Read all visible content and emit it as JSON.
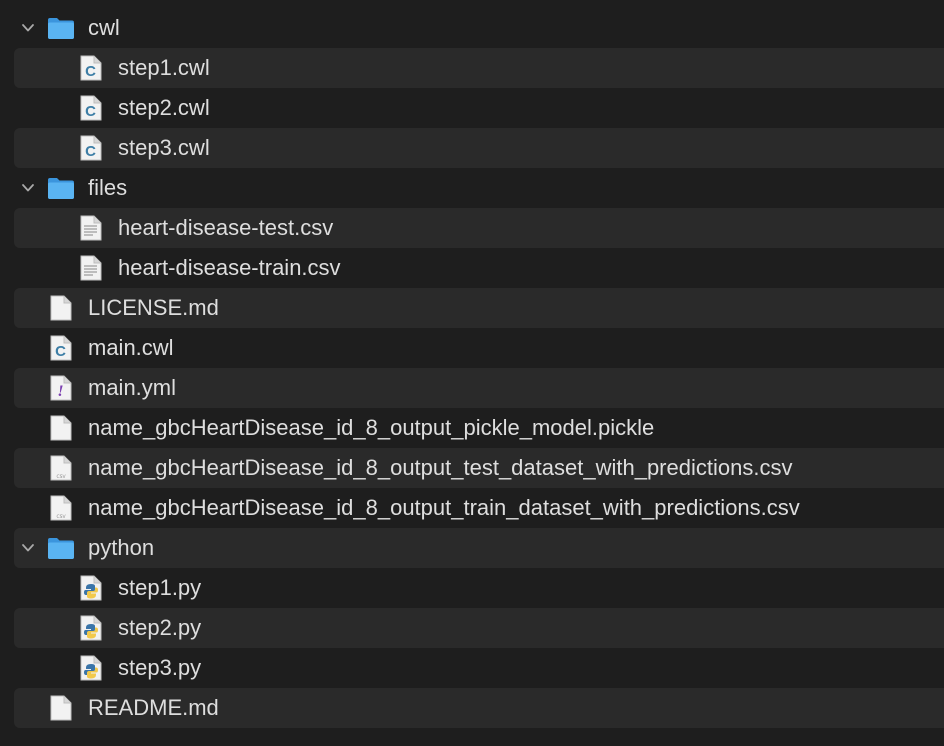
{
  "tree": [
    {
      "label": "cwl",
      "type": "folder",
      "depth": 0,
      "expanded": true,
      "icon": "folder-icon"
    },
    {
      "label": "step1.cwl",
      "type": "cwl",
      "depth": 1,
      "icon": "cwl-file-icon"
    },
    {
      "label": "step2.cwl",
      "type": "cwl",
      "depth": 1,
      "icon": "cwl-file-icon"
    },
    {
      "label": "step3.cwl",
      "type": "cwl",
      "depth": 1,
      "icon": "cwl-file-icon"
    },
    {
      "label": "files",
      "type": "folder",
      "depth": 0,
      "expanded": true,
      "icon": "folder-icon"
    },
    {
      "label": "heart-disease-test.csv",
      "type": "text",
      "depth": 1,
      "icon": "text-file-icon"
    },
    {
      "label": "heart-disease-train.csv",
      "type": "text",
      "depth": 1,
      "icon": "text-file-icon"
    },
    {
      "label": "LICENSE.md",
      "type": "blank",
      "depth": 0,
      "icon": "document-icon"
    },
    {
      "label": "main.cwl",
      "type": "cwl",
      "depth": 0,
      "icon": "cwl-file-icon"
    },
    {
      "label": "main.yml",
      "type": "yml",
      "depth": 0,
      "icon": "yaml-file-icon"
    },
    {
      "label": "name_gbcHeartDisease_id_8_output_pickle_model.pickle",
      "type": "blank",
      "depth": 0,
      "icon": "document-icon"
    },
    {
      "label": "name_gbcHeartDisease_id_8_output_test_dataset_with_predictions.csv",
      "type": "csv",
      "depth": 0,
      "icon": "csv-file-icon",
      "badge": "CSV"
    },
    {
      "label": "name_gbcHeartDisease_id_8_output_train_dataset_with_predictions.csv",
      "type": "csv",
      "depth": 0,
      "icon": "csv-file-icon",
      "badge": "CSV"
    },
    {
      "label": "python",
      "type": "folder",
      "depth": 0,
      "expanded": true,
      "icon": "folder-icon"
    },
    {
      "label": "step1.py",
      "type": "py",
      "depth": 1,
      "icon": "python-file-icon"
    },
    {
      "label": "step2.py",
      "type": "py",
      "depth": 1,
      "icon": "python-file-icon"
    },
    {
      "label": "step3.py",
      "type": "py",
      "depth": 1,
      "icon": "python-file-icon"
    },
    {
      "label": "README.md",
      "type": "blank",
      "depth": 0,
      "icon": "document-icon"
    }
  ],
  "colors": {
    "background": "#1e1e1e",
    "stripe": "#2a2a2a",
    "folder": "#4aa6ec",
    "cwl_letter": "#3d7ea6",
    "yml_mark": "#7b3fb0",
    "python_blue": "#3a74a8",
    "python_yellow": "#f2c94c"
  }
}
